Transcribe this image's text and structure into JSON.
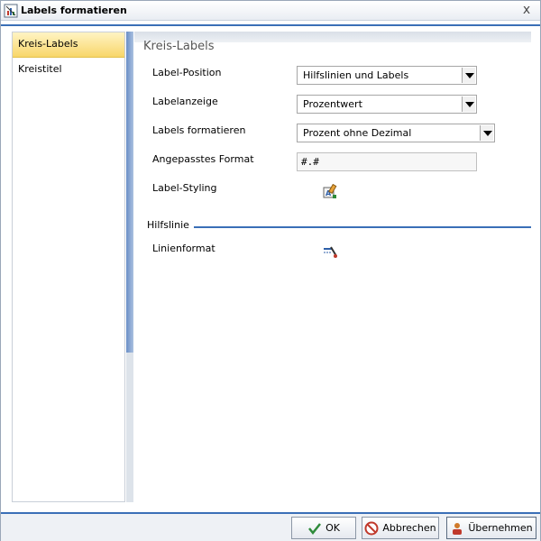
{
  "window": {
    "title": "Labels formatieren",
    "close_label": "x"
  },
  "nav": {
    "items": [
      {
        "label": "Kreis-Labels",
        "active": true
      },
      {
        "label": "Kreistitel",
        "active": false
      }
    ]
  },
  "content": {
    "section_title": "Kreis-Labels",
    "fields": {
      "label_position": {
        "label": "Label-Position",
        "value": "Hilfslinien und Labels"
      },
      "label_display": {
        "label": "Labelanzeige",
        "value": "Prozentwert"
      },
      "format_labels": {
        "label": "Labels formatieren",
        "value": "Prozent ohne Dezimal"
      },
      "custom_format": {
        "label": "Angepasstes Format",
        "value": "#.#"
      },
      "label_styling": {
        "label": "Label-Styling",
        "icon": "paint-style-icon"
      }
    },
    "guide_section": {
      "title": "Hilfslinie",
      "line_format": {
        "label": "Linienformat",
        "icon": "line-format-icon"
      }
    }
  },
  "buttons": {
    "ok": "OK",
    "cancel": "Abbrechen",
    "apply": "Übernehmen"
  },
  "colors": {
    "accent": "#3a6fb7",
    "nav_active": "#f8d66a"
  }
}
